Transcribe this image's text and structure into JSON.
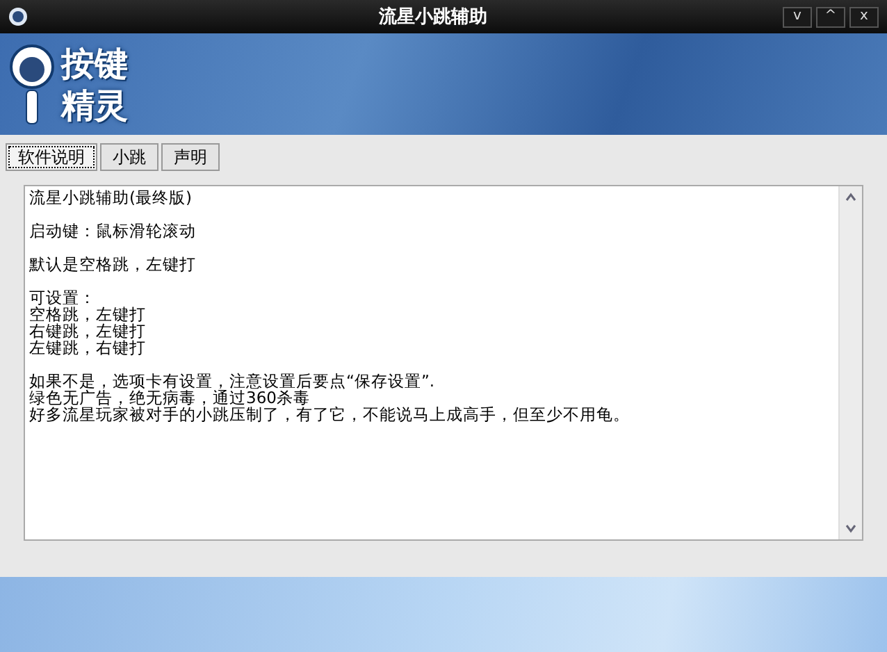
{
  "window": {
    "title": "流星小跳辅助",
    "controls": [
      "v",
      "^",
      "x"
    ]
  },
  "logo": {
    "lines": [
      "按键",
      "精灵"
    ]
  },
  "tabs": [
    {
      "label": "软件说明",
      "selected": true
    },
    {
      "label": "小跳",
      "selected": false
    },
    {
      "label": "声明",
      "selected": false
    }
  ],
  "content": {
    "paragraphs": [
      [
        "流星小跳辅助(最终版)"
      ],
      [
        "启动键：鼠标滑轮滚动"
      ],
      [
        "默认是空格跳，左键打"
      ],
      [
        "可设置：",
        "空格跳，左键打",
        "右键跳，左键打",
        "左键跳，右键打"
      ],
      [
        "如果不是，选项卡有设置，注意设置后要点“保存设置”.",
        "绿色无广告，绝无病毒，通过360杀毒",
        "好多流星玩家被对手的小跳压制了，有了它，不能说马上成高手，但至少不用龟。"
      ]
    ]
  }
}
